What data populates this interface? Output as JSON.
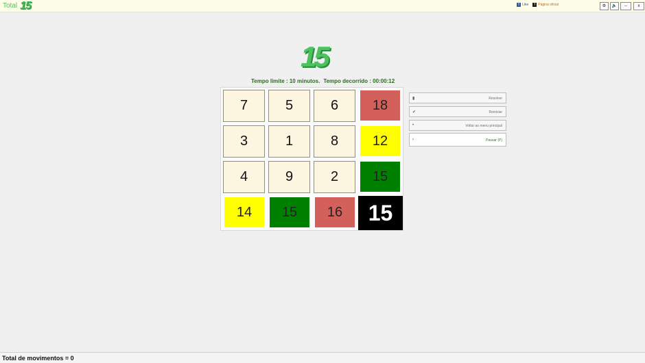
{
  "header": {
    "brand_text": "Total",
    "brand_logo": "15",
    "link_like": "Like",
    "link_official": "Página oficial",
    "buttons": [
      {
        "icon": "settings-icon",
        "glyph": "⚙"
      },
      {
        "icon": "sound-icon",
        "glyph": "🔈"
      },
      {
        "icon": "minimize-icon",
        "glyph": "–"
      },
      {
        "icon": "close-icon",
        "glyph": "x"
      }
    ]
  },
  "game": {
    "logo": "15",
    "time_limit": "Tempo limite : 10 minutos.",
    "elapsed": "Tempo decorrido : 00:00:12",
    "tiles": [
      {
        "value": "7",
        "color": "cream"
      },
      {
        "value": "5",
        "color": "cream"
      },
      {
        "value": "6",
        "color": "cream"
      },
      {
        "value": "18",
        "color": "red"
      },
      {
        "value": "3",
        "color": "cream"
      },
      {
        "value": "1",
        "color": "cream"
      },
      {
        "value": "8",
        "color": "cream"
      },
      {
        "value": "12",
        "color": "yellow"
      },
      {
        "value": "4",
        "color": "cream"
      },
      {
        "value": "9",
        "color": "cream"
      },
      {
        "value": "2",
        "color": "cream"
      },
      {
        "value": "15",
        "color": "green"
      },
      {
        "value": "14",
        "color": "yellow"
      },
      {
        "value": "15",
        "color": "green"
      },
      {
        "value": "16",
        "color": "red"
      },
      {
        "value": "15",
        "color": "black"
      }
    ]
  },
  "side": {
    "solve": "Resolver",
    "restart": "Reiniciar",
    "menu": "Voltar ao menu principal",
    "pause": "Pausar (P)"
  },
  "footer": {
    "moves": "Total de movimentos = 0"
  }
}
